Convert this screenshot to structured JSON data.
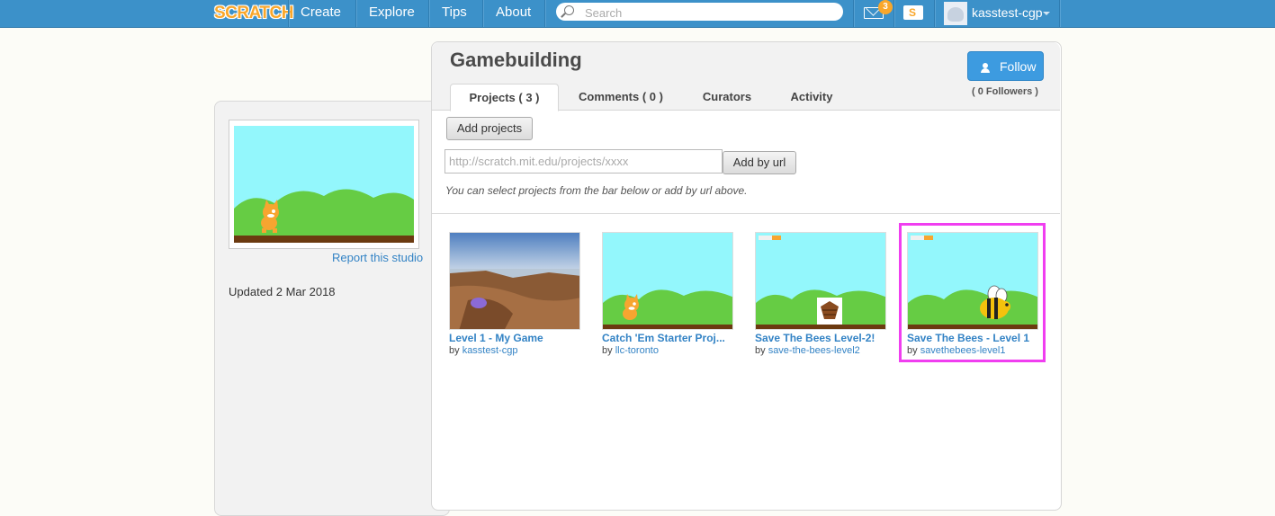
{
  "nav": {
    "logo": "SCRATCH",
    "items": [
      "Create",
      "Explore",
      "Tips",
      "About"
    ],
    "search_placeholder": "Search",
    "message_count": "3",
    "mystuff_glyph": "S",
    "username": "kasstest-cgp"
  },
  "sidebar": {
    "report_link": "Report this studio",
    "updated": "Updated 2 Mar 2018"
  },
  "studio": {
    "title": "Gamebuilding",
    "tabs": [
      "Projects ( 3 )",
      "Comments ( 0 )",
      "Curators",
      "Activity"
    ],
    "follow_label": "Follow",
    "followers": "( 0 Followers )",
    "add_projects_label": "Add projects",
    "url_placeholder": "http://scratch.mit.edu/projects/xxxx",
    "add_by_url_label": "Add by url",
    "hint": "You can select projects from the bar below or add by url above."
  },
  "projects": [
    {
      "title": "Level 1 - My Game",
      "by": "by ",
      "author": "kasstest-cgp",
      "thumb": "photo"
    },
    {
      "title": "Catch 'Em Starter Proj...",
      "by": "by ",
      "author": "llc-toronto",
      "thumb": "cat"
    },
    {
      "title": "Save The Bees Level-2!",
      "by": "by ",
      "author": "save-the-bees-level2",
      "thumb": "beehive"
    },
    {
      "title": "Save The Bees - Level 1",
      "by": "by ",
      "author": "savethebees-level1",
      "thumb": "bee"
    }
  ],
  "colors": {
    "topbar": "#3c91c9",
    "link": "#3383c5",
    "highlight": "#f03ef0",
    "sky": "#93f7fc",
    "grass": "#66cc44"
  }
}
